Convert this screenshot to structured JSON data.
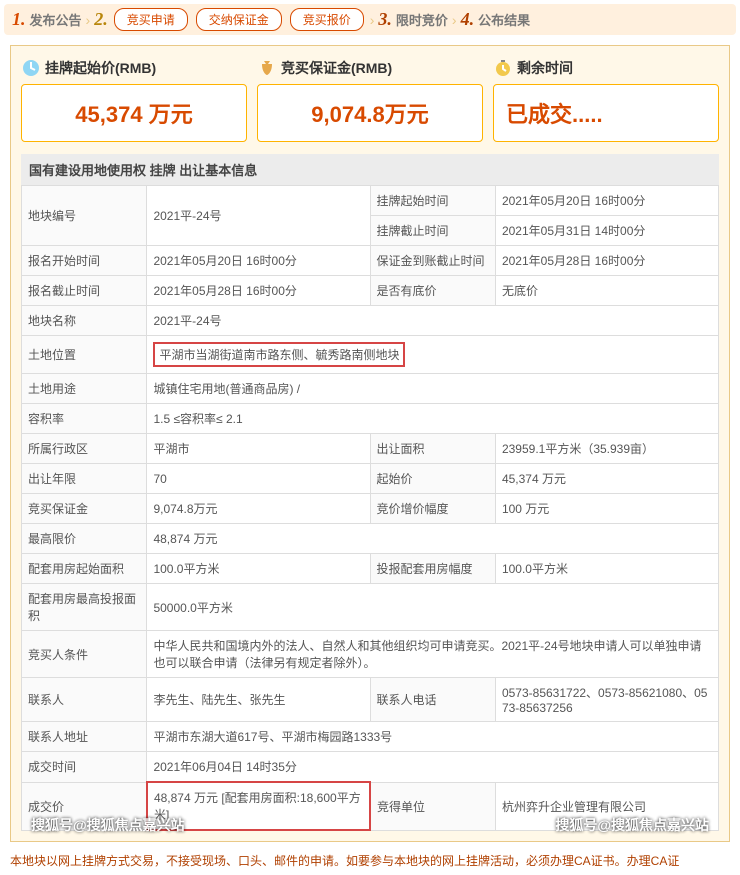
{
  "steps": {
    "s1n": "1.",
    "s1": "发布公告",
    "s2n": "2.",
    "s2a": "竞买申请",
    "s2b": "交纳保证金",
    "s2c": "竞买报价",
    "s3n": "3.",
    "s3": "限时竞价",
    "s4n": "4.",
    "s4": "公布结果"
  },
  "metrics": {
    "m1_label": "挂牌起始价(RMB)",
    "m1_value": "45,374 万元",
    "m2_label": "竞买保证金(RMB)",
    "m2_value": "9,074.8万元",
    "m3_label": "剩余时间",
    "m3_value": "已成交....."
  },
  "section_title": "国有建设用地使用权 挂牌 出让基本信息",
  "labels": {
    "r1a": "地块编号",
    "r1c": "挂牌起始时间",
    "r1e": "挂牌截止时间",
    "r2a": "报名开始时间",
    "r2c": "保证金到账截止时间",
    "r3a": "报名截止时间",
    "r3c": "是否有底价",
    "r4a": "地块名称",
    "r5a": "土地位置",
    "r6a": "土地用途",
    "r7a": "容积率",
    "r8a": "所属行政区",
    "r8c": "出让面积",
    "r9a": "出让年限",
    "r9c": "起始价",
    "r10a": "竞买保证金",
    "r10c": "竞价增价幅度",
    "r11a": "最高限价",
    "r12a": "配套用房起始面积",
    "r12c": "投报配套用房幅度",
    "r13a": "配套用房最高投报面积",
    "r14a": "竞买人条件",
    "r15a": "联系人",
    "r15c": "联系人电话",
    "r16a": "联系人地址",
    "r17a": "成交时间",
    "r18a": "成交价",
    "r18c": "竞得单位"
  },
  "vals": {
    "r1b": "2021平-24号",
    "r1d": "2021年05月20日 16时00分",
    "r1f": "2021年05月31日 14时00分",
    "r2b": "2021年05月20日 16时00分",
    "r2d": "2021年05月28日 16时00分",
    "r3b": "2021年05月28日 16时00分",
    "r3d": "无底价",
    "r4b": "2021平-24号",
    "r5b": "平湖市当湖街道南市路东侧、毓秀路南侧地块",
    "r6b": "城镇住宅用地(普通商品房) /",
    "r7b": "1.5 ≤容积率≤ 2.1",
    "r8b": "平湖市",
    "r8d": "23959.1平方米（35.939亩）",
    "r9b": "70",
    "r9d": "45,374 万元",
    "r10b": "9,074.8万元",
    "r10d": "100 万元",
    "r11b": "48,874 万元",
    "r12b": "100.0平方米",
    "r12d": "100.0平方米",
    "r13b": "50000.0平方米",
    "r14b": "中华人民共和国境内外的法人、自然人和其他组织均可申请竞买。2021平-24号地块申请人可以单独申请也可以联合申请（法律另有规定者除外）。",
    "r15b": "李先生、陆先生、张先生",
    "r15d": "0573-85631722、0573-85621080、0573-85637256",
    "r16b": "平湖市东湖大道617号、平湖市梅园路1333号",
    "r17b": "2021年06月04日 14时35分",
    "r18b": "48,874 万元 [配套用房面积:18,600平方米]",
    "r18d": "杭州弈升企业管理有限公司"
  },
  "foot": "本地块以网上挂牌方式交易，不接受现场、口头、邮件的申请。如要参与本地块的网上挂牌活动，必须办理CA证书。办理CA证",
  "wm": "搜狐号@搜狐焦点嘉兴站"
}
